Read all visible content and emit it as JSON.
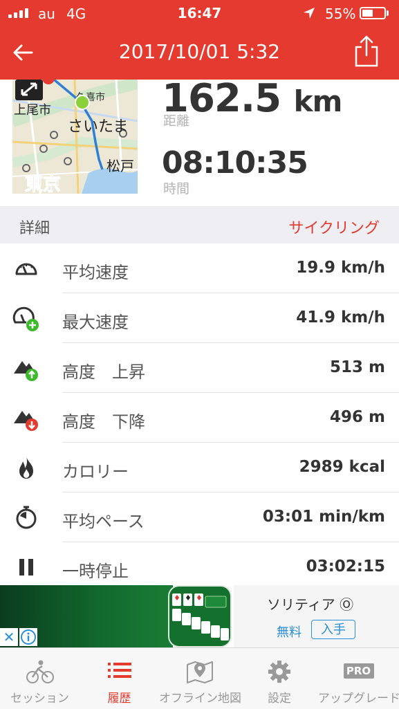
{
  "status_bar": {
    "carrier": "au",
    "network": "4G",
    "time": "16:47",
    "battery": "55%",
    "battery_level": 0.55
  },
  "header": {
    "title": "2017/10/01 5:32",
    "back_icon": "back-arrow-icon",
    "share_icon": "share-icon"
  },
  "map": {
    "place_labels": [
      "久喜市",
      "上尾市",
      "さいたま",
      "松戸",
      "東京"
    ],
    "expand_icon": "expand-icon"
  },
  "summary": {
    "distance_value": "162.5",
    "distance_unit": "km",
    "distance_label": "距離",
    "time_value": "08:10:35",
    "time_label": "時間"
  },
  "details": {
    "title": "詳細",
    "activity_type": "サイクリング",
    "rows": [
      {
        "label": "平均速度",
        "value": "19.9 km/h",
        "icon": "speedometer-icon"
      },
      {
        "label": "最大速度",
        "value": "41.9 km/h",
        "icon": "speedometer-plus-icon"
      },
      {
        "label": "高度　上昇",
        "value": "513 m",
        "icon": "mountain-up-icon"
      },
      {
        "label": "高度　下降",
        "value": "496 m",
        "icon": "mountain-down-icon"
      },
      {
        "label": "カロリー",
        "value": "2989 kcal",
        "icon": "flame-icon"
      },
      {
        "label": "平均ペース",
        "value": "03:01 min/km",
        "icon": "stopwatch-icon"
      },
      {
        "label": "一時停止",
        "value": "03:02:15",
        "icon": "pause-icon"
      }
    ]
  },
  "ad": {
    "app_name": "ソリティア Ⓞ",
    "price": "無料",
    "get_label": "入手",
    "close_icon": "close-icon",
    "info_icon": "info-icon"
  },
  "tabs": [
    {
      "label": "セッション",
      "icon": "cyclist-icon",
      "active": false
    },
    {
      "label": "履歴",
      "icon": "list-icon",
      "active": true
    },
    {
      "label": "オフライン地図",
      "icon": "map-pin-icon",
      "active": false
    },
    {
      "label": "設定",
      "icon": "gear-icon",
      "active": false
    },
    {
      "label": "アップグレード",
      "icon": "pro-badge-icon",
      "badge": "PRO",
      "active": false
    }
  ],
  "colors": {
    "accent": "#e53a2f",
    "link": "#2a8fd8",
    "green": "#3cba2c"
  }
}
